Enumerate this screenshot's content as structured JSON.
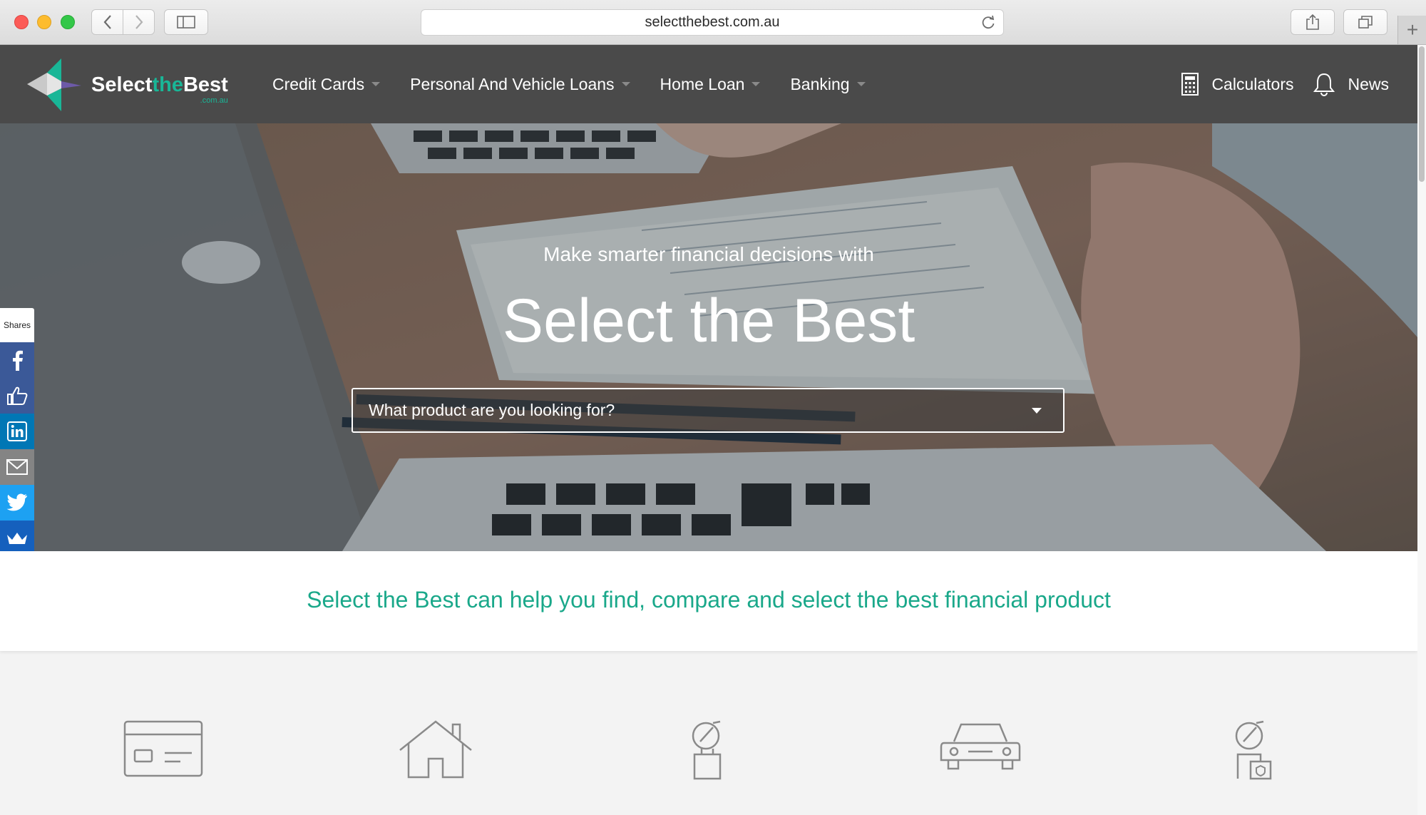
{
  "browser": {
    "url": "selectthebest.com.au"
  },
  "header": {
    "logo": {
      "brand_select": "Select",
      "brand_the": "the",
      "brand_best": "Best",
      "brand_domain": ".com.au"
    },
    "nav": [
      {
        "label": "Credit Cards"
      },
      {
        "label": "Personal And Vehicle Loans"
      },
      {
        "label": "Home Loan"
      },
      {
        "label": "Banking"
      }
    ],
    "right_nav": [
      {
        "label": "Calculators",
        "icon": "calculator-icon"
      },
      {
        "label": "News",
        "icon": "bell-icon"
      }
    ]
  },
  "hero": {
    "subtitle": "Make smarter financial decisions with",
    "title": "Select the Best",
    "search_placeholder": "What product are you looking for?"
  },
  "share_bar": {
    "label": "Shares",
    "buttons": [
      {
        "icon": "facebook-icon",
        "color": "#3b5998"
      },
      {
        "icon": "like-icon",
        "color": "#3b5998"
      },
      {
        "icon": "linkedin-icon",
        "color": "#0077b5"
      },
      {
        "icon": "email-icon",
        "color": "#848484"
      },
      {
        "icon": "twitter-icon",
        "color": "#1da1f2"
      },
      {
        "icon": "sumome-crown-icon",
        "color": "#1560bd"
      }
    ]
  },
  "tagline": "Select the Best can help you find, compare and select the best financial product",
  "categories": [
    {
      "icon": "credit-card-icon"
    },
    {
      "icon": "house-icon"
    },
    {
      "icon": "person-loan-icon"
    },
    {
      "icon": "car-icon"
    },
    {
      "icon": "person-insurance-icon"
    }
  ],
  "colors": {
    "brand_green": "#19b697",
    "header_bg": "#4a4a4a",
    "tagline_green": "#1aa88a"
  }
}
